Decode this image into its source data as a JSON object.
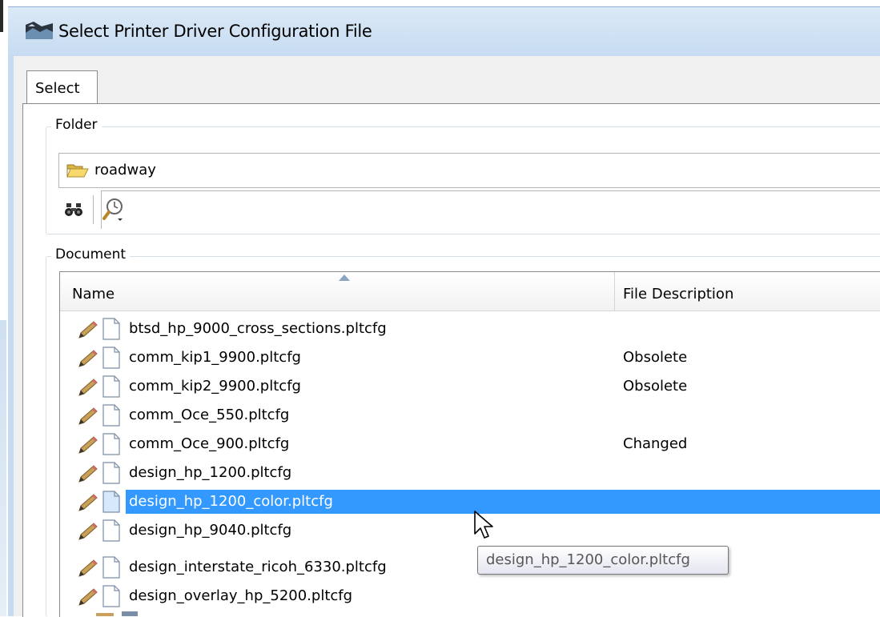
{
  "window": {
    "title": "Select Printer Driver Configuration File"
  },
  "tabs": [
    {
      "label": "Select",
      "active": true
    }
  ],
  "folder_group": {
    "legend": "Folder",
    "path": "roadway"
  },
  "document_group": {
    "legend": "Document"
  },
  "list": {
    "columns": {
      "name": "Name",
      "description": "File Description"
    },
    "sort": {
      "column": "Name",
      "direction": "ascending"
    },
    "rows": [
      {
        "name": "btsd_hp_9000_cross_sections.pltcfg",
        "description": ""
      },
      {
        "name": "comm_kip1_9900.pltcfg",
        "description": "Obsolete"
      },
      {
        "name": "comm_kip2_9900.pltcfg",
        "description": "Obsolete"
      },
      {
        "name": "comm_Oce_550.pltcfg",
        "description": ""
      },
      {
        "name": "comm_Oce_900.pltcfg",
        "description": "Changed"
      },
      {
        "name": "design_hp_1200.pltcfg",
        "description": ""
      },
      {
        "name": "design_hp_1200_color.pltcfg",
        "description": "",
        "selected": true
      },
      {
        "name": "design_hp_9040.pltcfg",
        "description": ""
      },
      {
        "name": "design_interstate_ricoh_6330.pltcfg",
        "description": ""
      },
      {
        "name": "design_overlay_hp_5200.pltcfg",
        "description": ""
      }
    ],
    "selected_color": "#3399ff"
  },
  "tooltip": {
    "text": "design_hp_1200_color.pltcfg"
  },
  "icons": {
    "app": "printer-app-icon",
    "folder": "open-folder-icon",
    "find": "binoculars-icon",
    "search_options": "magnifier-clock-icon",
    "row_edit": "pencil-icon",
    "row_file": "document-icon"
  }
}
